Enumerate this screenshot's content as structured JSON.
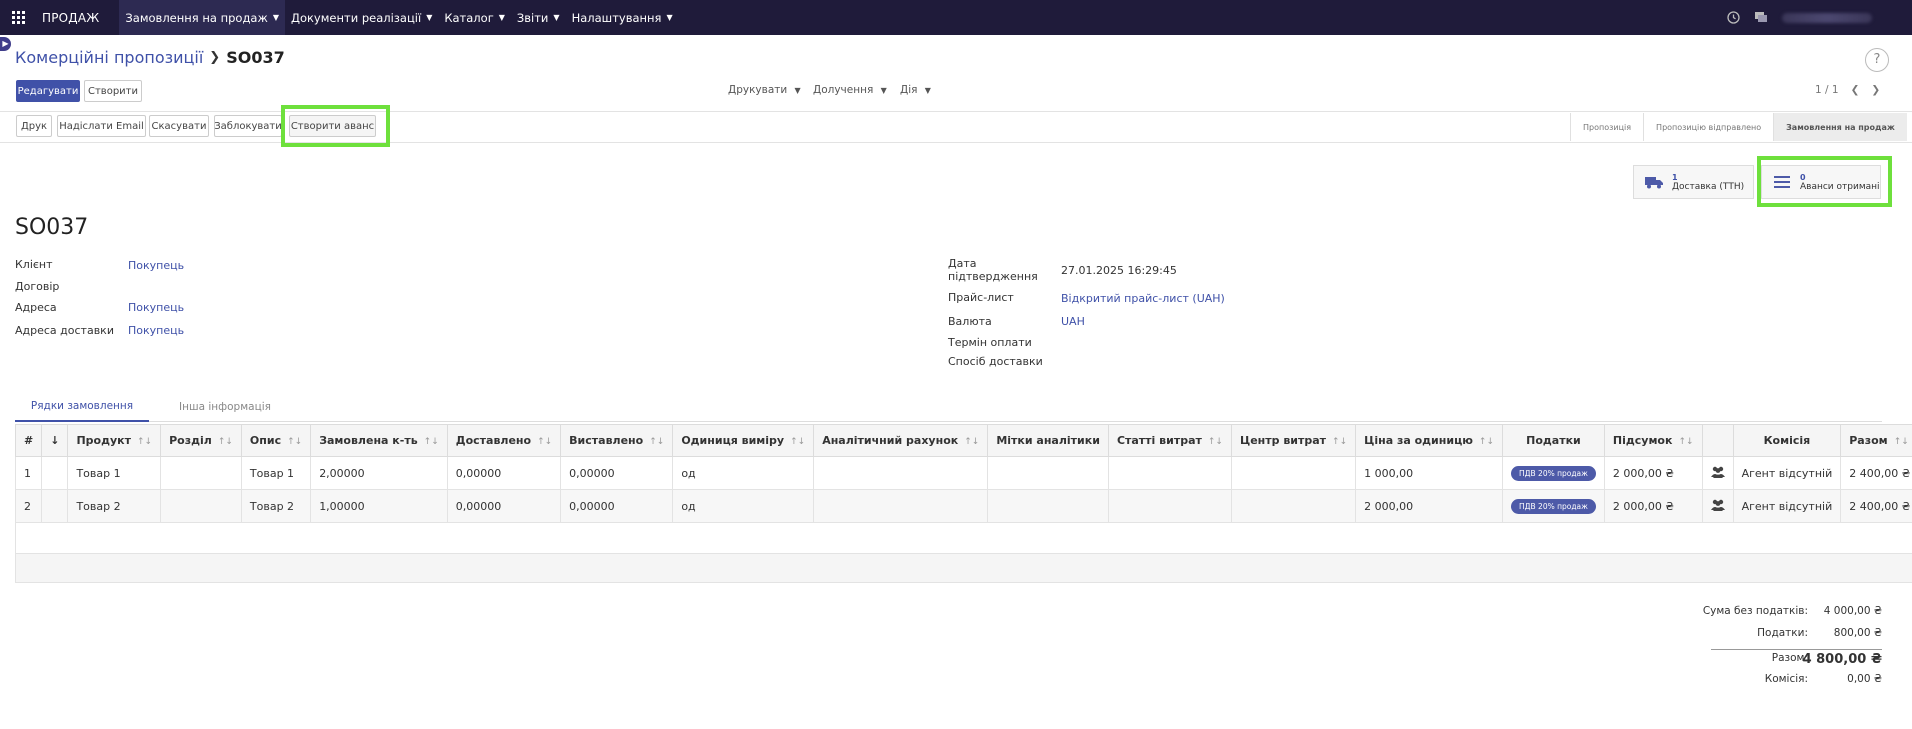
{
  "navbar": {
    "brand": "ПРОДАЖ",
    "menu": [
      {
        "label": "Замовлення на продаж"
      },
      {
        "label": "Документи реалізації"
      },
      {
        "label": "Каталог"
      },
      {
        "label": "Звіти"
      },
      {
        "label": "Налаштування"
      }
    ]
  },
  "breadcrumb": {
    "parent": "Комерційні пропозиції",
    "current": "SO037"
  },
  "help_label": "?",
  "actions": {
    "edit": "Редагувати",
    "create": "Створити"
  },
  "dropdowns": {
    "print": "Друкувати",
    "attach": "Долучення",
    "action": "Дія"
  },
  "pager": {
    "text": "1 / 1"
  },
  "header_buttons": {
    "print": "Друк",
    "send_email": "Надіслати Email",
    "cancel": "Скасувати",
    "lock": "Заблокувати",
    "create_advance": "Створити аванс"
  },
  "stages": [
    "Пропозиція",
    "Пропозицію відправлено",
    "Замовлення на продаж"
  ],
  "smart_buttons": {
    "delivery": {
      "count": "1",
      "label": "Доставка (ТТН)"
    },
    "advances": {
      "count": "0",
      "label": "Аванси отримані"
    }
  },
  "record": {
    "name": "SO037",
    "left": {
      "client_label": "Клієнт",
      "client": "Покупець",
      "contract_label": "Договір",
      "address_label": "Адреса",
      "address": "Покупець",
      "delivery_address_label": "Адреса доставки",
      "delivery_address": "Покупець"
    },
    "right": {
      "confirm_date_label_1": "Дата",
      "confirm_date_label_2": "підтвердження",
      "confirm_date": "27.01.2025 16:29:45",
      "pricelist_label": "Прайс-лист",
      "pricelist": "Відкритий прайс-лист (UAH)",
      "currency_label": "Валюта",
      "currency": "UAH",
      "payment_terms_label": "Термін оплати",
      "delivery_method_label": "Спосіб доставки"
    }
  },
  "tabs": [
    "Рядки замовлення",
    "Інша інформація"
  ],
  "table": {
    "columns": [
      "#",
      "↓",
      "Продукт",
      "Розділ",
      "Опис",
      "Замовлена к-ть",
      "Доставлено",
      "Виставлено",
      "Одиниця виміру",
      "Аналітичний рахунок",
      "Мітки аналітики",
      "Статті витрат",
      "Центр витрат",
      "Ціна за одиницю",
      "Податки",
      "Підсумок",
      "",
      "Комісія",
      "Разом"
    ],
    "sort_icon": "↑↓",
    "rows": [
      {
        "num": "1",
        "product": "Товар 1",
        "section": "",
        "description": "Товар 1",
        "qty": "2,00000",
        "delivered": "0,00000",
        "invoiced": "0,00000",
        "uom": "од",
        "analytic": "",
        "tags": "",
        "expense": "",
        "cost_center": "",
        "price": "1 000,00",
        "tax": "ПДВ 20% продаж",
        "subtotal": "2 000,00 ₴",
        "commission": "Агент відсутній",
        "total": "2 400,00 ₴"
      },
      {
        "num": "2",
        "product": "Товар 2",
        "section": "",
        "description": "Товар 2",
        "qty": "1,00000",
        "delivered": "0,00000",
        "invoiced": "0,00000",
        "uom": "од",
        "analytic": "",
        "tags": "",
        "expense": "",
        "cost_center": "",
        "price": "2 000,00",
        "tax": "ПДВ 20% продаж",
        "subtotal": "2 000,00 ₴",
        "commission": "Агент відсутній",
        "total": "2 400,00 ₴"
      }
    ]
  },
  "totals": {
    "untaxed_label": "Сума без податків:",
    "untaxed": "4 000,00 ₴",
    "taxes_label": "Податки:",
    "taxes": "800,00 ₴",
    "total_label": "Разом:",
    "total": "4 800,00 ₴",
    "commission_label": "Комісія:",
    "commission": "0,00 ₴"
  },
  "colors": {
    "navbar": "#1f1b3a",
    "accent": "#4051a8",
    "highlight": "#6ee03c"
  }
}
